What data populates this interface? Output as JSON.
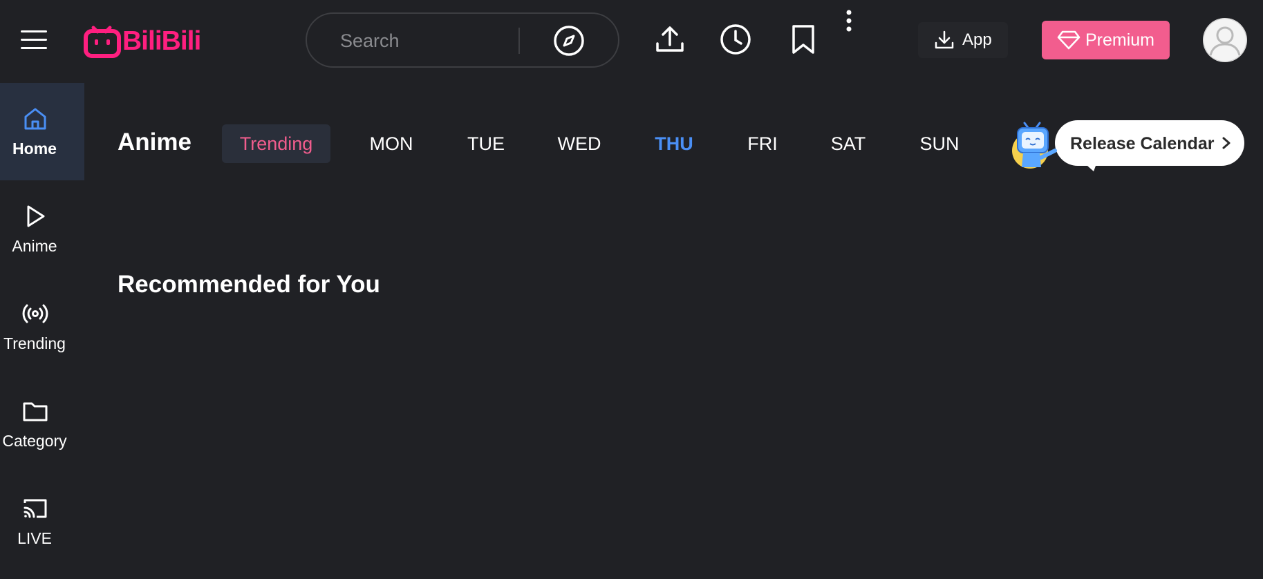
{
  "brand": {
    "name": "BiliBili",
    "color": "#ff1f80"
  },
  "header": {
    "search_placeholder": "Search",
    "app_label": "App",
    "premium_label": "Premium",
    "icons": [
      "menu-icon",
      "compass-icon",
      "upload-icon",
      "history-icon",
      "bookmark-icon",
      "more-vertical-icon",
      "download-icon",
      "diamond-icon",
      "user-avatar-icon"
    ]
  },
  "sidebar": {
    "items": [
      {
        "label": "Home",
        "icon": "home-icon",
        "active": true
      },
      {
        "label": "Anime",
        "icon": "play-icon",
        "active": false
      },
      {
        "label": "Trending",
        "icon": "broadcast-icon",
        "active": false
      },
      {
        "label": "Category",
        "icon": "folder-icon",
        "active": false
      },
      {
        "label": "LIVE",
        "icon": "cast-icon",
        "active": false
      }
    ]
  },
  "main": {
    "section_title": "Anime",
    "tabs": [
      "Trending",
      "MON",
      "TUE",
      "WED",
      "THU",
      "FRI",
      "SAT",
      "SUN"
    ],
    "selected_tab": "Trending",
    "today_tab": "THU",
    "calendar_label": "Release Calendar",
    "recommended_title": "Recommended for You"
  },
  "colors": {
    "background": "#202125",
    "accent_pink": "#f25d8e",
    "today_blue": "#4a8ff5",
    "active_sidebar": "#283040"
  }
}
